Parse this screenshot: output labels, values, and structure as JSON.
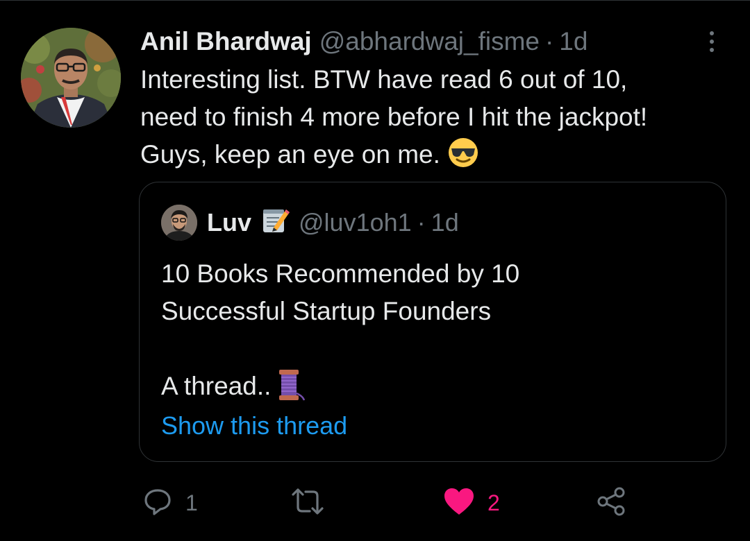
{
  "tweet": {
    "author_name": "Anil Bhardwaj",
    "author_handle": "@abhardwaj_fisme",
    "separator": "·",
    "time": "1d",
    "text_lines": [
      "Interesting list. BTW have read 6 out of 10,",
      "need to finish 4 more before I hit the jackpot!",
      "Guys, keep an eye on me."
    ],
    "emoji": "smiling-face-with-sunglasses"
  },
  "quote": {
    "author_name": "Luv",
    "name_emoji": "memo",
    "author_handle": "@luv1oh1",
    "separator": "·",
    "time": "1d",
    "text_lines": [
      "10 Books Recommended by 10",
      "Successful Startup Founders",
      "",
      "A thread.."
    ],
    "thread_emoji": "thread-spool",
    "show_thread_label": "Show this thread"
  },
  "actions": {
    "reply_count": "1",
    "retweet_count": "",
    "like_count": "2",
    "liked": true
  },
  "colors": {
    "background": "#000000",
    "text_primary": "#e7e9ea",
    "text_secondary": "#6e767d",
    "link": "#1d9bf0",
    "like": "#f91880",
    "border": "#2f3336"
  }
}
